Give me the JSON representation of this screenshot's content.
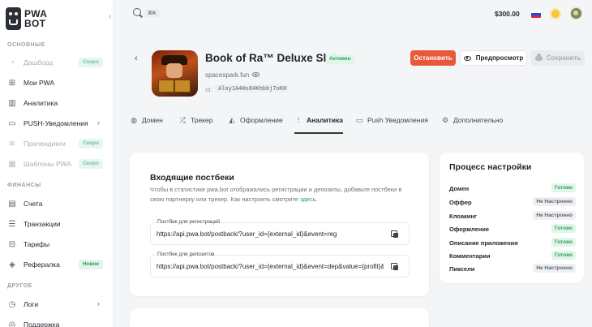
{
  "brand": {
    "name_line1": "PWA",
    "name_line2": "BOT"
  },
  "sidebar": {
    "sections": [
      {
        "title": "ОСНОВНЫЕ"
      },
      {
        "title": "ФИНАНСЫ"
      },
      {
        "title": "ДРУГОЕ"
      }
    ],
    "items": [
      {
        "label": "Дашборд",
        "icon": "dashboard-icon",
        "badge": "Скоро"
      },
      {
        "label": "Мои PWA",
        "icon": "my-pwa-icon"
      },
      {
        "label": "Аналитика",
        "icon": "analytics-icon"
      },
      {
        "label": "PUSH-Уведомления",
        "icon": "push-icon",
        "chevron": "›"
      },
      {
        "label": "Прелендинги",
        "icon": "prelanding-icon",
        "badge": "Скоро"
      },
      {
        "label": "Шаблоны PWA",
        "icon": "templates-icon",
        "badge": "Скоро"
      },
      {
        "label": "Счета",
        "icon": "bills-icon"
      },
      {
        "label": "Транзакции",
        "icon": "transactions-icon"
      },
      {
        "label": "Тарифы",
        "icon": "tariffs-icon"
      },
      {
        "label": "Рефералка",
        "icon": "referral-icon",
        "badge": "Новое"
      },
      {
        "label": "Логи",
        "icon": "logs-icon",
        "chevron": "›"
      },
      {
        "label": "Поддержка",
        "icon": "support-icon"
      }
    ]
  },
  "topbar": {
    "search_hint": "⌘K",
    "balance": "$300.00",
    "flag_colors": [
      "#ffffff",
      "#1f4fd6",
      "#d9263a"
    ]
  },
  "app": {
    "title": "Book of Ra™ Deluxe Slot",
    "status": "Активен",
    "domain": "spacespark.fun",
    "id_label": "Id:",
    "id_value": "Aloy1A4Hs84Khbbj7oKH"
  },
  "actions": {
    "stop": "Остановить",
    "preview": "Предпросмотр",
    "save": "Сохранить"
  },
  "tabs": [
    {
      "label": "Домен"
    },
    {
      "label": "Трекер"
    },
    {
      "label": "Оформление"
    },
    {
      "label": "Аналитика",
      "active": true
    },
    {
      "label": "Push Уведомления"
    },
    {
      "label": "Дополнительно"
    }
  ],
  "postbacks": {
    "title": "Входящие постбеки",
    "description": "Чтобы в статистике pwa.bot отображались регистрации и депозиты, добавьте постбеки в свою партнерку или трекер. Как настроить смотрите ",
    "description_link": "здесь",
    "description_end": ".",
    "fields": [
      {
        "label": "Постбек для регистраций",
        "value": "https://api.pwa.bot/postback/?user_id={external_id}&event=reg"
      },
      {
        "label": "Постбек для депозитов",
        "value": "https://api.pwa.bot/postback/?user_id={external_id}&event=dep&value={profit}&c"
      }
    ]
  },
  "setup": {
    "title": "Процесс настройки",
    "steps": [
      {
        "name": "Домен",
        "state": "Готово",
        "done": true
      },
      {
        "name": "Оффер",
        "state": "Не Настроено",
        "done": false
      },
      {
        "name": "Клоакинг",
        "state": "Не Настроено",
        "done": false
      },
      {
        "name": "Оформление",
        "state": "Готово",
        "done": true
      },
      {
        "name": "Описание приложения",
        "state": "Готово",
        "done": true
      },
      {
        "name": "Комментарии",
        "state": "Готово",
        "done": true
      },
      {
        "name": "Пиксели",
        "state": "Не Настроено",
        "done": false
      }
    ]
  }
}
